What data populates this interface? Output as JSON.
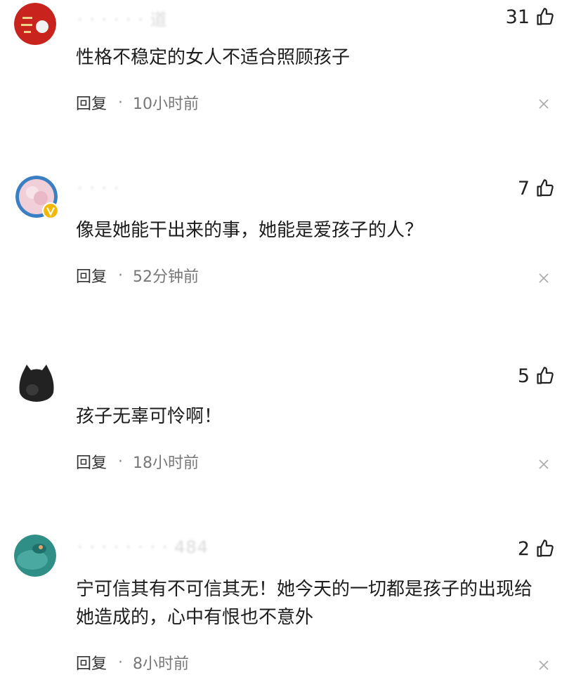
{
  "comments": [
    {
      "username": "· · · · · · 道",
      "likes": "31",
      "text": "性格不稳定的女人不适合照顾孩子",
      "reply": "回复",
      "time": "10小时前"
    },
    {
      "username": "· · · ·",
      "likes": "7",
      "text": "像是她能干出来的事，她能是爱孩子的人？",
      "reply": "回复",
      "time": "52分钟前"
    },
    {
      "username": "",
      "likes": "5",
      "text": "孩子无辜可怜啊！",
      "reply": "回复",
      "time": "18小时前"
    },
    {
      "username": "· · · · · · · · 484",
      "likes": "2",
      "text": "宁可信其有不可信其无！她今天的一切都是孩子的出现给她造成的，心中有恨也不意外",
      "reply": "回复",
      "time": "8小时前"
    }
  ],
  "separator": "·",
  "icons": {
    "like": "thumbs-up-icon",
    "close": "close-icon",
    "verified": "verified-badge-icon"
  },
  "colors": {
    "background": "#ffffff",
    "text": "#1d1d1d",
    "meta": "#777777",
    "verified": "#f5b800"
  }
}
